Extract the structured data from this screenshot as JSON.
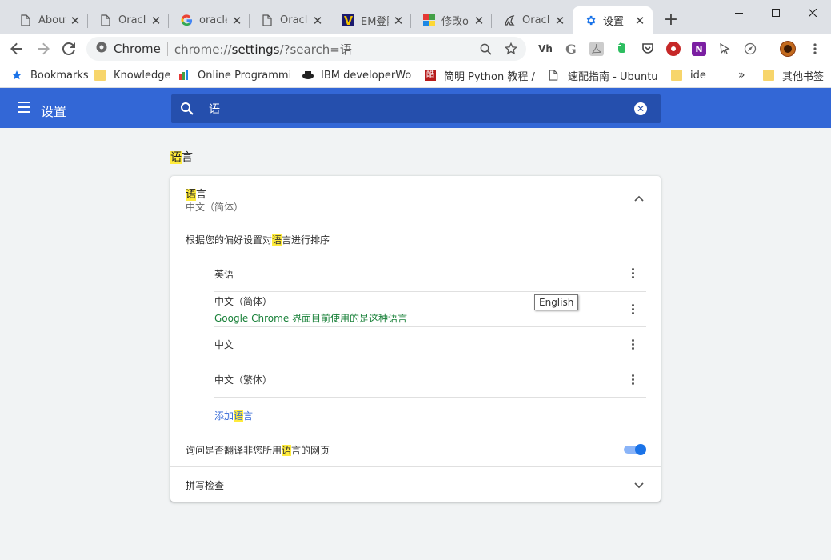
{
  "tabs": [
    {
      "title": "About",
      "favicon": "document-icon"
    },
    {
      "title": "Oracle",
      "favicon": "document-icon"
    },
    {
      "title": "oracle",
      "favicon": "google-icon"
    },
    {
      "title": "Oracle",
      "favicon": "document-icon"
    },
    {
      "title": "EM登陆",
      "favicon": "em-icon"
    },
    {
      "title": "修改ora",
      "favicon": "puzzle-icon"
    },
    {
      "title": "Oracle",
      "favicon": "oracle-bird-icon"
    },
    {
      "title": "设置",
      "favicon": "gear-icon",
      "active": true
    }
  ],
  "omnibox": {
    "site": "Chrome",
    "url_scheme": "chrome://",
    "url_host": "settings",
    "url_rest": "/?search=语"
  },
  "extensions": [
    "vh",
    "G",
    "acrobat",
    "evernote",
    "pocket",
    "red-circle",
    "N",
    "cursor",
    "compass"
  ],
  "bookmarks": [
    {
      "label": "Bookmarks",
      "icon": "star-icon"
    },
    {
      "label": "Knowledge",
      "icon": "folder-icon"
    },
    {
      "label": "Online Programmin",
      "icon": "site-icon"
    },
    {
      "label": "IBM developerWorl",
      "icon": "ibm-icon"
    },
    {
      "label": "简明 Python 教程 / ",
      "icon": "site-icon"
    },
    {
      "label": "速配指南 - Ubuntu中",
      "icon": "document-icon"
    },
    {
      "label": "ide",
      "icon": "folder-icon"
    },
    {
      "label": "其他书签",
      "icon": "folder-icon"
    }
  ],
  "overflow": "»",
  "settings": {
    "header_title": "设置",
    "search_value": "语"
  },
  "section": {
    "title_hl": "语",
    "title_rest": "言"
  },
  "languages": {
    "title_hl": "语",
    "title_rest": "言",
    "current": "中文（简体）",
    "order_pre": "根据您的偏好设置对",
    "order_hl": "语",
    "order_post": "言进行排序",
    "list": [
      {
        "name": "英语",
        "note": ""
      },
      {
        "name": "中文（简体）",
        "note": "Google Chrome 界面目前使用的是这种语言"
      },
      {
        "name": "中文",
        "note": ""
      },
      {
        "name": "中文（繁体）",
        "note": ""
      }
    ],
    "tooltip": "English",
    "add_pre": "添加",
    "add_hl": "语",
    "add_post": "言",
    "translate_pre": "询问是否翻译非您所用",
    "translate_hl": "语",
    "translate_post": "言的网页",
    "translate_enabled": true
  },
  "spellcheck": {
    "title": "拼写检查"
  },
  "colors": {
    "header": "#3367d6",
    "search_box": "#254fad",
    "highlight": "#ffeb3b",
    "toggle": "#1a73e8",
    "note_green": "#188038"
  }
}
